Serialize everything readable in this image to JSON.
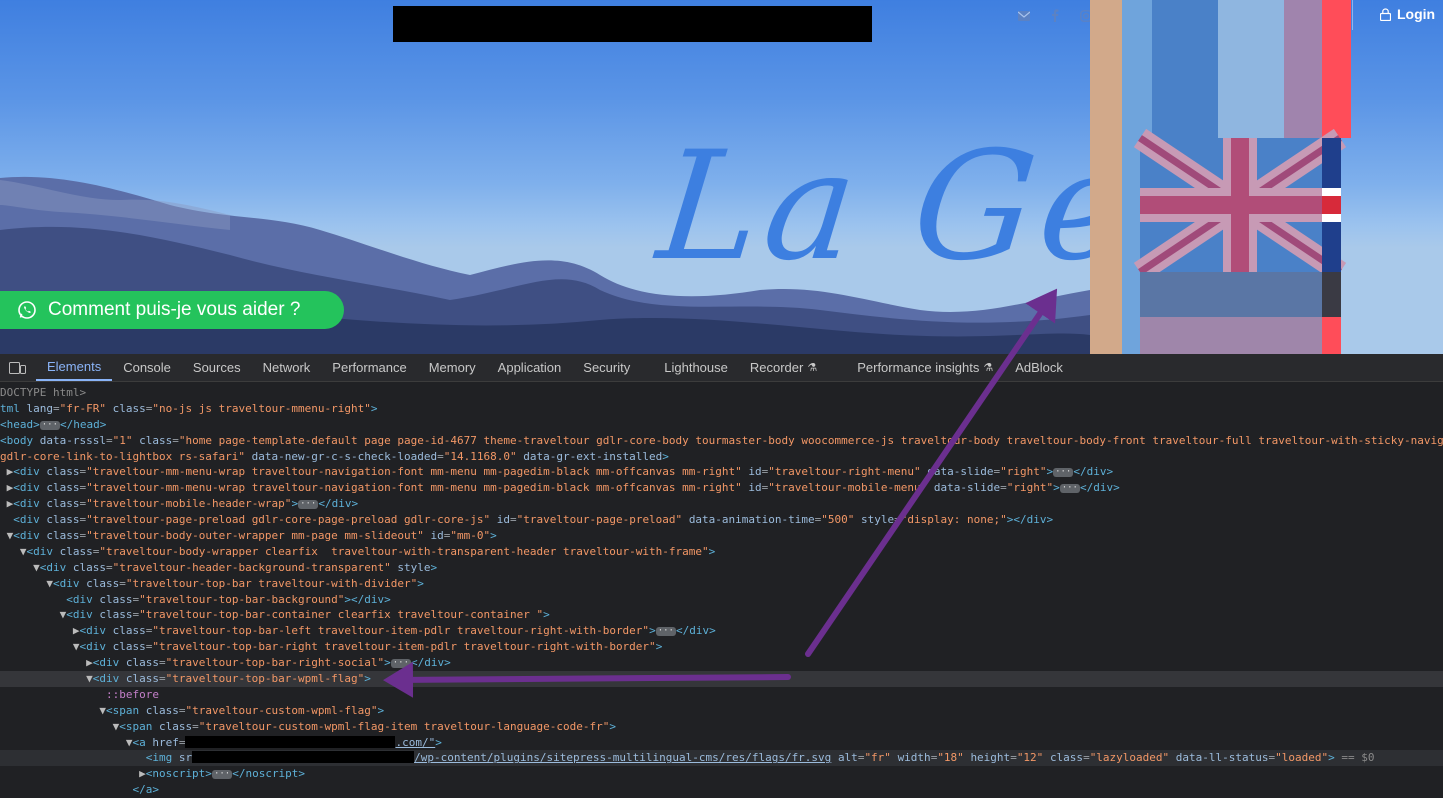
{
  "site": {
    "social_icons": [
      "envelope-icon",
      "facebook-icon",
      "instagram-icon"
    ],
    "login_label": "Login",
    "logo_text": "La Géor",
    "whatsapp_label": "Comment puis-je vous aider ?",
    "whatsapp_color": "#24c35c"
  },
  "devtools": {
    "tabs": [
      "Elements",
      "Console",
      "Sources",
      "Network",
      "Performance",
      "Memory",
      "Application",
      "Security",
      "Lighthouse",
      "Recorder",
      "Performance insights",
      "AdBlock"
    ],
    "active_tab": "Elements",
    "lines": {
      "l0": "DOCTYPE html>",
      "l1_tag": "tml",
      "l1_lang": "\"fr-FR\"",
      "l1_class": "\"no-js js traveltour-mmenu-right\"",
      "l3_class": "\"home page-template-default page page-id-4677 theme-traveltour gdlr-core-body tourmaster-body woocommerce-js traveltour-body traveltour-body-front traveltour-full traveltour-with-sticky-navig",
      "l4_cont": "gdlr-core-link-to-lightbox rs-safari\"",
      "l4_attr1": "data-new-gr-c-s-check-loaded",
      "l4_val1": "\"14.1168.0\"",
      "l4_attr2": "data-gr-ext-installed",
      "l5_class": "\"traveltour-mm-menu-wrap traveltour-navigation-font mm-menu mm-pagedim-black mm-offcanvas mm-right\"",
      "l5_id": "\"traveltour-right-menu\"",
      "l5_slide": "\"right\"",
      "l6_id": "\"traveltour-mobile-menu\"",
      "l6_slide": "\"right\"",
      "l7_class": "\"traveltour-mobile-header-wrap\"",
      "l8_class": "\"traveltour-page-preload gdlr-core-page-preload gdlr-core-js\"",
      "l8_id": "\"traveltour-page-preload\"",
      "l8_time": "\"500\"",
      "l8_style": "\"display: none;\"",
      "l9_class": "\"traveltour-body-outer-wrapper mm-page mm-slideout\"",
      "l9_id": "\"mm-0\"",
      "l10_class": "\"traveltour-body-wrapper clearfix  traveltour-with-transparent-header traveltour-with-frame\"",
      "l11_class": "\"traveltour-header-background-transparent\"",
      "l12_class": "\"traveltour-top-bar traveltour-with-divider\"",
      "l13_class": "\"traveltour-top-bar-background\"",
      "l14_class": "\"traveltour-top-bar-container clearfix traveltour-container \"",
      "l15_class": "\"traveltour-top-bar-left traveltour-item-pdlr traveltour-right-with-border\"",
      "l16_class": "\"traveltour-top-bar-right traveltour-item-pdlr traveltour-right-with-border\"",
      "l17_class": "\"traveltour-top-bar-right-social\"",
      "l18_class": "\"traveltour-top-bar-wpml-flag\"",
      "l19": "::before",
      "l20_class": "\"traveltour-custom-wpml-flag\"",
      "l21_class": "\"traveltour-custom-wpml-flag-item traveltour-language-code-fr\"",
      "l22_href_end": ".com/\"",
      "l23_src_end": "/wp-content/plugins/sitepress-multilingual-cms/res/flags/fr.svg",
      "l23_alt": "\"fr\"",
      "l23_w": "\"18\"",
      "l23_h": "\"12\"",
      "l23_class": "\"lazyloaded\"",
      "l23_status": "\"loaded\"",
      "l23_sel": "== $0"
    }
  }
}
